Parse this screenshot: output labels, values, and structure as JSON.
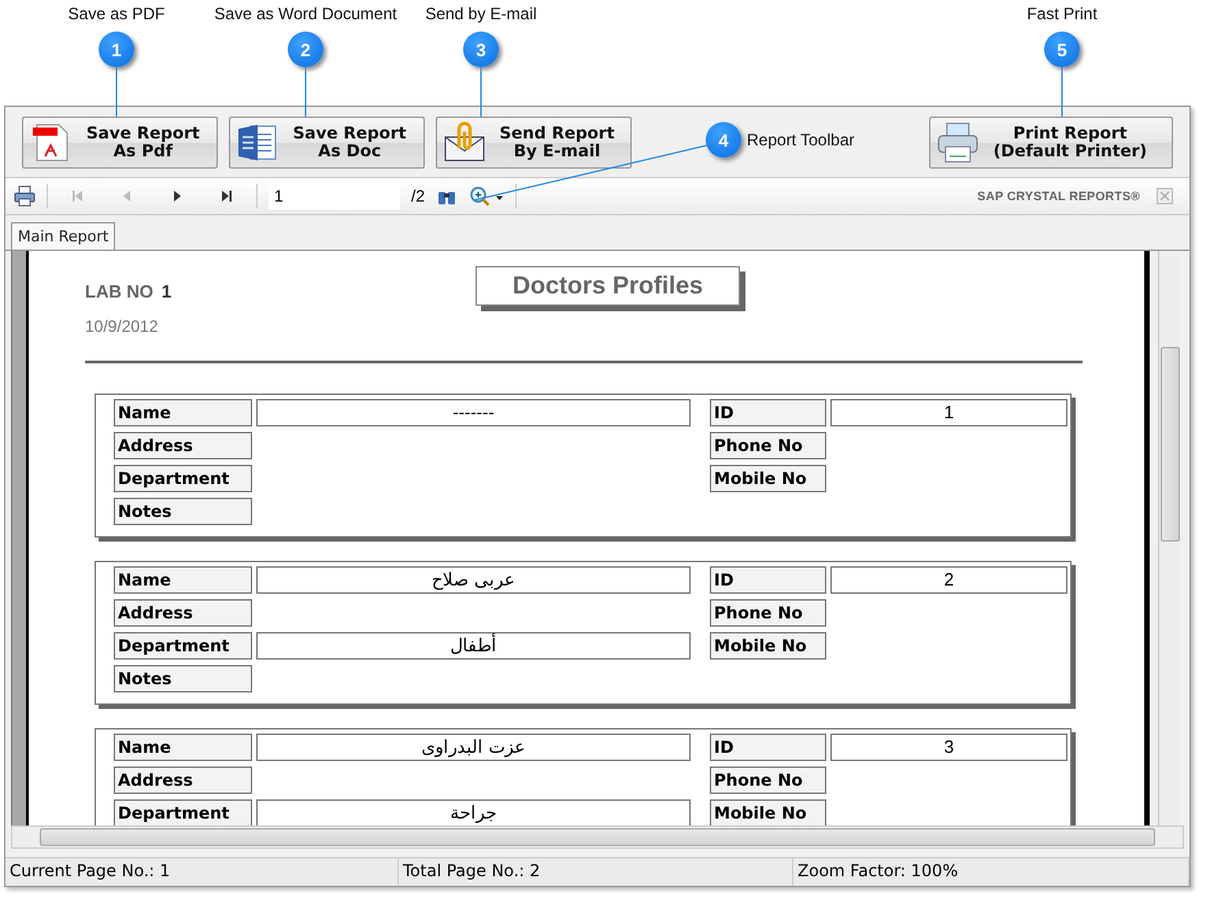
{
  "callouts": [
    {
      "number": "1",
      "label": "Save as PDF"
    },
    {
      "number": "2",
      "label": "Save as Word Document"
    },
    {
      "number": "3",
      "label": "Send by E-mail"
    },
    {
      "number": "4",
      "label": "Report Toolbar"
    },
    {
      "number": "5",
      "label": "Fast Print"
    }
  ],
  "action_buttons": [
    {
      "kind": "pdf",
      "lines": [
        "Save Report",
        "As Pdf"
      ]
    },
    {
      "kind": "doc",
      "lines": [
        "Save Report",
        "As Doc"
      ]
    },
    {
      "kind": "mail",
      "lines": [
        "Send Report",
        "By E-mail"
      ]
    },
    {
      "kind": "print",
      "lines": [
        "Print Report",
        "(Default Printer)"
      ]
    }
  ],
  "toolbar": {
    "nav": [
      {
        "kind": "first",
        "disabled": true
      },
      {
        "kind": "prev",
        "disabled": true
      },
      {
        "kind": "next",
        "disabled": false
      },
      {
        "kind": "last",
        "disabled": false
      }
    ],
    "page_field": "1",
    "page_total": "/2",
    "brand": "SAP CRYSTAL REPORTS®"
  },
  "tabs": [
    {
      "label": "Main Report",
      "selected": true
    }
  ],
  "report": {
    "lab_label": "LAB NO",
    "lab_no": "1",
    "date": "10/9/2012",
    "title": "Doctors Profiles",
    "cards": [
      {
        "rows": [
          {
            "left": {
              "label": "Name",
              "value": "-------"
            },
            "right": {
              "label": "ID",
              "value": "1"
            }
          },
          {
            "left": {
              "label": "Address"
            },
            "right": {
              "label": "Phone No"
            }
          },
          {
            "left": {
              "label": "Department"
            },
            "right": {
              "label": "Mobile No"
            }
          },
          {
            "left": {
              "label": "Notes"
            }
          }
        ]
      },
      {
        "rows": [
          {
            "left": {
              "label": "Name",
              "value": "عربى صلاح"
            },
            "right": {
              "label": "ID",
              "value": "2"
            }
          },
          {
            "left": {
              "label": "Address"
            },
            "right": {
              "label": "Phone No"
            }
          },
          {
            "left": {
              "label": "Department",
              "value": "أطفال"
            },
            "right": {
              "label": "Mobile No"
            }
          },
          {
            "left": {
              "label": "Notes"
            }
          }
        ]
      },
      {
        "rows": [
          {
            "left": {
              "label": "Name",
              "value": "عزت البدراوى"
            },
            "right": {
              "label": "ID",
              "value": "3"
            }
          },
          {
            "left": {
              "label": "Address"
            },
            "right": {
              "label": "Phone No"
            }
          },
          {
            "left": {
              "label": "Department",
              "value": "جراحة"
            },
            "right": {
              "label": "Mobile No"
            }
          }
        ]
      }
    ]
  },
  "status_bar": [
    "Current Page No.: 1",
    "Total Page No.: 2",
    "Zoom Factor: 100%"
  ]
}
